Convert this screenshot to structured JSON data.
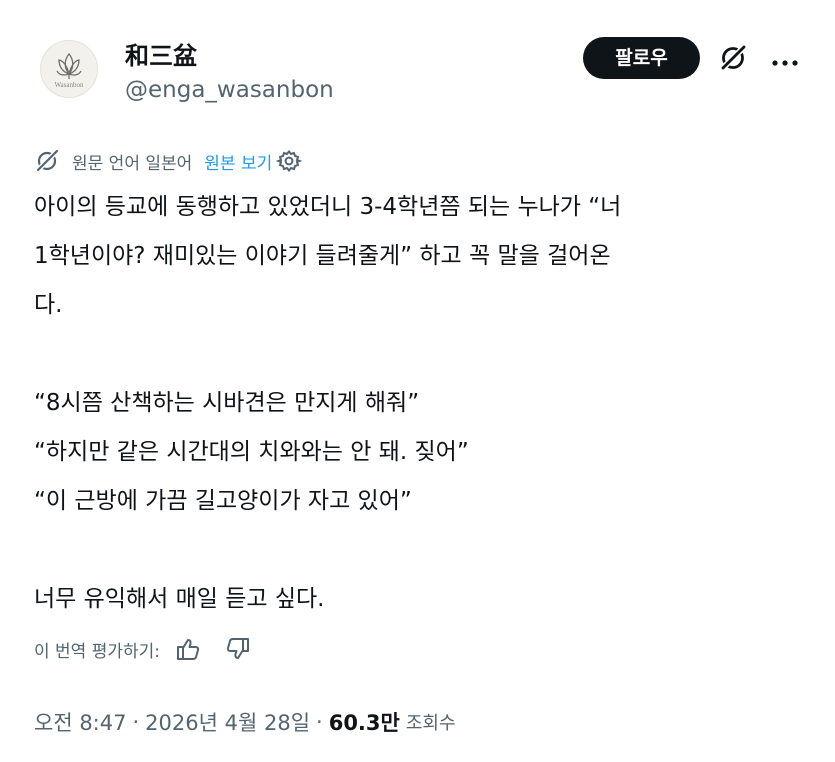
{
  "author": {
    "display_name": "和三盆",
    "handle": "@enga_wasanbon",
    "avatar_text": "Wasanbon"
  },
  "actions": {
    "follow_label": "팔로우",
    "grok_icon": "grok-icon",
    "more_icon": "more-horizontal-icon"
  },
  "translation": {
    "label": "원문 언어 일본어",
    "show_original": "원본 보기",
    "settings_icon": "gear-icon"
  },
  "tweet": {
    "lines": [
      "아이의 등교에 동행하고 있었더니 3-4학년쯤 되는 누나가 “너",
      "1학년이야? 재미있는 이야기 들려줄게” 하고 꼭 말을 걸어온",
      "다.",
      "",
      "“8시쯤 산책하는 시바견은 만지게 해줘”",
      "“하지만 같은 시간대의 치와와는 안 돼. 짖어”",
      "“이 근방에 가끔 길고양이가 자고 있어”",
      "",
      "너무 유익해서 매일 듣고 싶다."
    ]
  },
  "rating": {
    "label": "이 번역 평가하기:",
    "thumbs_up_icon": "thumbs-up-icon",
    "thumbs_down_icon": "thumbs-down-icon"
  },
  "meta": {
    "time": "오전 8:47",
    "separator": "·",
    "date": "2026년 4월 28일",
    "views_count": "60.3만",
    "views_label": "조회수"
  },
  "colors": {
    "text_primary": "#0f1419",
    "text_secondary": "#536471",
    "link": "#1d9bf0",
    "follow_button_bg": "#0f1419"
  }
}
